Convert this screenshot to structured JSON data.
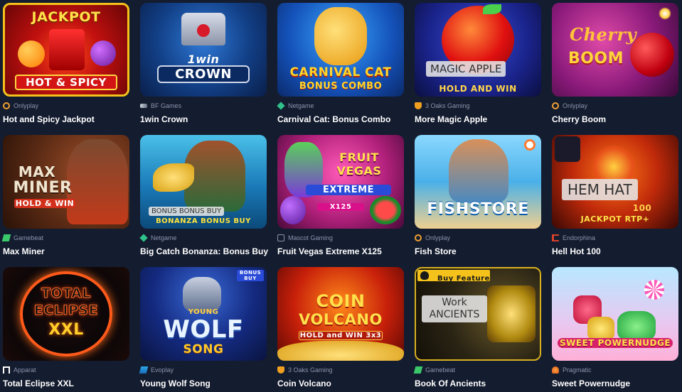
{
  "games": [
    {
      "name": "Hot and Spicy Jackpot",
      "provider": "Onlyplay",
      "art": {
        "line1": "JACKPOT",
        "line2": "HOT & SPICY"
      }
    },
    {
      "name": "1win Crown",
      "provider": "BF Games",
      "art": {
        "line1": "1win",
        "line2": "CROWN"
      }
    },
    {
      "name": "Carnival Cat: Bonus Combo",
      "provider": "Netgame",
      "art": {
        "line1": "CARNIVAL CAT",
        "line2": "BONUS COMBO"
      }
    },
    {
      "name": "More Magic Apple",
      "provider": "3 Oaks Gaming",
      "art": {
        "chip": "MAGIC APPLE",
        "line2": "HOLD AND WIN"
      }
    },
    {
      "name": "Cherry Boom",
      "provider": "Onlyplay",
      "art": {
        "line1": "Cherry",
        "line2": "BOOM"
      }
    },
    {
      "name": "Max Miner",
      "provider": "Gamebeat",
      "art": {
        "line1": "MAX",
        "line2": "MINER",
        "line3": "HOLD & WIN"
      }
    },
    {
      "name": "Big Catch Bonanza: Bonus Buy",
      "provider": "Netgame",
      "art": {
        "chip": "BONUS BONUS BUY",
        "line2": "BONANZA BONUS BUY"
      }
    },
    {
      "name": "Fruit Vegas Extreme X125",
      "provider": "Mascot Gaming",
      "art": {
        "line1": "FRUIT VEGAS",
        "line2": "EXTREME",
        "line3": "X125"
      }
    },
    {
      "name": "Fish Store",
      "provider": "Onlyplay",
      "art": {
        "line1": "FISHSTORE"
      }
    },
    {
      "name": "Hell Hot 100",
      "provider": "Endorphina",
      "art": {
        "chip": "HEM HAT",
        "line2": "100",
        "line3": "JACKPOT RTP+"
      }
    },
    {
      "name": "Total Eclipse XXL",
      "provider": "Apparat",
      "art": {
        "line1": "TOTAL",
        "line2": "ECLIPSE",
        "line3": "XXL"
      }
    },
    {
      "name": "Young Wolf Song",
      "provider": "Evoplay",
      "art": {
        "badge": "BONUS BUY",
        "line1": "YOUNG",
        "line2": "WOLF",
        "line3": "SONG"
      }
    },
    {
      "name": "Coin Volcano",
      "provider": "3 Oaks Gaming",
      "art": {
        "line1": "COIN",
        "line2": "VOLCANO",
        "line3": "HOLD and WIN 3x3"
      }
    },
    {
      "name": "Book Of Ancients",
      "provider": "Gamebeat",
      "art": {
        "badge": "Buy Feature",
        "chip1": "Work",
        "chip2": "ANCIENTS"
      }
    },
    {
      "name": "Sweet Powernudge",
      "provider": "Pragmatic",
      "art": {
        "line1": "SWEET POWERNUDGE"
      }
    }
  ],
  "colors": {
    "background": "#141c2f",
    "provider_text": "#8a94ad",
    "title_text": "#ffffff"
  }
}
